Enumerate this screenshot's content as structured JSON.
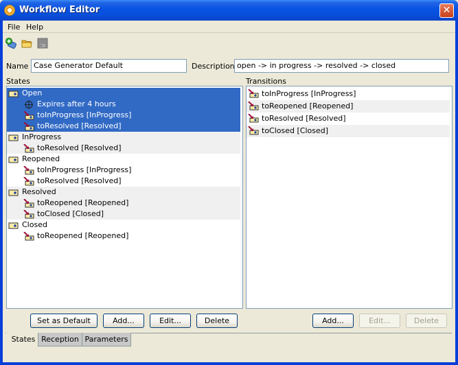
{
  "window": {
    "title": "Workflow Editor",
    "close_label": "✕"
  },
  "menu": [
    {
      "label": "File"
    },
    {
      "label": "Help"
    }
  ],
  "toolbar": [
    {
      "icon": "new-workflow-icon",
      "enabled": true
    },
    {
      "icon": "open-folder-icon",
      "enabled": true
    },
    {
      "icon": "save-disk-icon",
      "enabled": false
    }
  ],
  "form": {
    "name_label": "Name",
    "name_value": "Case Generator Default",
    "description_label": "Description",
    "description_value": "open -> in progress -> resolved -> closed"
  },
  "states": {
    "header": "States",
    "rows": [
      {
        "type": "state",
        "label": "Open",
        "indent": 0,
        "selected": true,
        "alt": false
      },
      {
        "type": "timer",
        "label": "Expires after 4 hours",
        "indent": 1,
        "selected": true,
        "alt": false
      },
      {
        "type": "transition",
        "label": "toInProgress [InProgress]",
        "indent": 1,
        "selected": true,
        "alt": false
      },
      {
        "type": "transition",
        "label": "toResolved [Resolved]",
        "indent": 1,
        "selected": true,
        "alt": false
      },
      {
        "type": "state",
        "label": "InProgress",
        "indent": 0,
        "selected": false,
        "alt": true
      },
      {
        "type": "transition",
        "label": "toResolved [Resolved]",
        "indent": 1,
        "selected": false,
        "alt": true
      },
      {
        "type": "state",
        "label": "Reopened",
        "indent": 0,
        "selected": false,
        "alt": false
      },
      {
        "type": "transition",
        "label": "toInProgress [InProgress]",
        "indent": 1,
        "selected": false,
        "alt": false
      },
      {
        "type": "transition",
        "label": "toResolved [Resolved]",
        "indent": 1,
        "selected": false,
        "alt": false
      },
      {
        "type": "state",
        "label": "Resolved",
        "indent": 0,
        "selected": false,
        "alt": true
      },
      {
        "type": "transition",
        "label": "toReopened [Reopened]",
        "indent": 1,
        "selected": false,
        "alt": true
      },
      {
        "type": "transition",
        "label": "toClosed [Closed]",
        "indent": 1,
        "selected": false,
        "alt": true
      },
      {
        "type": "state",
        "label": "Closed",
        "indent": 0,
        "selected": false,
        "alt": false
      },
      {
        "type": "transition",
        "label": "toReopened [Reopened]",
        "indent": 1,
        "selected": false,
        "alt": false
      }
    ],
    "buttons": [
      {
        "label": "Set as Default",
        "enabled": true
      },
      {
        "label": "Add...",
        "enabled": true
      },
      {
        "label": "Edit...",
        "enabled": true
      },
      {
        "label": "Delete",
        "enabled": true
      }
    ]
  },
  "transitions": {
    "header": "Transitions",
    "rows": [
      {
        "label": "toInProgress [InProgress]",
        "alt": false
      },
      {
        "label": "toReopened [Reopened]",
        "alt": true
      },
      {
        "label": "toResolved [Resolved]",
        "alt": false
      },
      {
        "label": "toClosed [Closed]",
        "alt": true
      }
    ],
    "buttons": [
      {
        "label": "Add...",
        "enabled": true
      },
      {
        "label": "Edit...",
        "enabled": false
      },
      {
        "label": "Delete",
        "enabled": false
      }
    ]
  },
  "tabs": [
    {
      "label": "States",
      "active": true
    },
    {
      "label": "Reception",
      "active": false
    },
    {
      "label": "Parameters",
      "active": false
    }
  ],
  "colors": {
    "selection": "#316ac5",
    "titlebar": "#0a54e2",
    "field_border": "#7f9db9",
    "transition_arrow": "#a0103a"
  }
}
